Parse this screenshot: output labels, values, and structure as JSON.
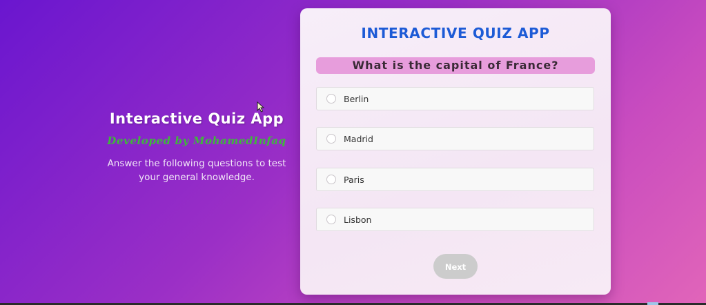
{
  "intro": {
    "title": "Interactive Quiz App",
    "credit": "Developed by MohamedInfaq",
    "description": "Answer the following questions to test your general knowledge."
  },
  "quiz": {
    "title": "INTERACTIVE QUIZ APP",
    "question": "What is the capital of France?",
    "options": [
      {
        "label": "Berlin",
        "selected": false
      },
      {
        "label": "Madrid",
        "selected": false
      },
      {
        "label": "Paris",
        "selected": false
      },
      {
        "label": "Lisbon",
        "selected": false
      }
    ],
    "next_label": "Next"
  },
  "colors": {
    "title_blue": "#1d5bd6",
    "question_bg": "#e79ddc",
    "credit_green": "#3fb83a",
    "next_disabled": "#cccccc"
  },
  "icons": {
    "cursor": "mouse-pointer-icon",
    "radio": "radio-circle-icon"
  }
}
